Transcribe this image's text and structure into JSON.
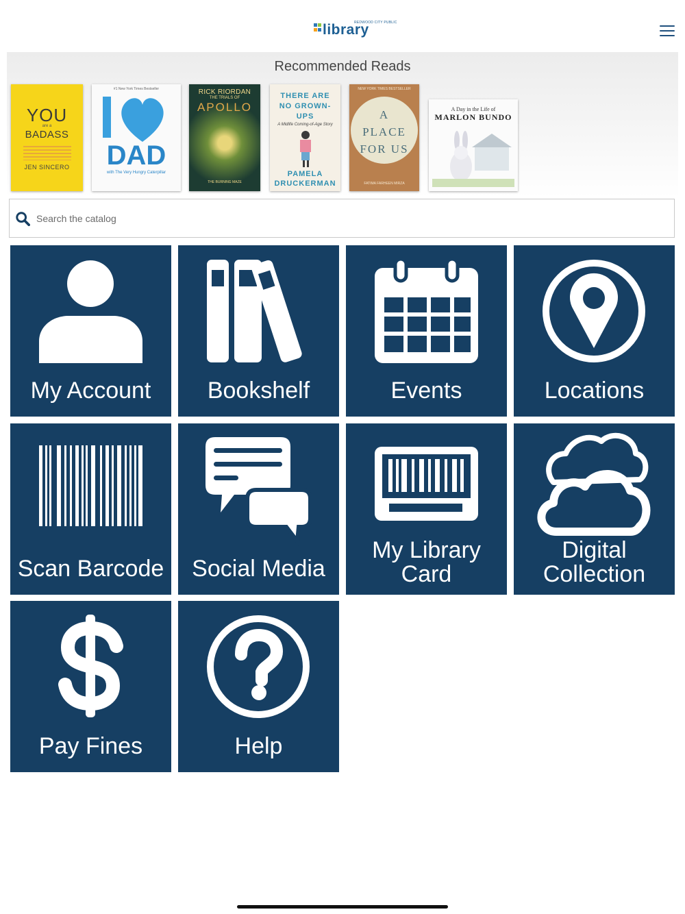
{
  "header": {
    "logo_small": "REDWOOD CITY PUBLIC",
    "logo_word": "library",
    "logo_mark_colors": [
      "#2e79b7",
      "#8cc63f",
      "#f7a21b",
      "#2e79b7"
    ],
    "menu_icon": "hamburger-menu-icon"
  },
  "recommended": {
    "title": "Recommended Reads",
    "books": [
      {
        "title_top": "YOU",
        "title_mid": "are a",
        "title_main": "BADASS",
        "author": "JEN SINCERO",
        "bg": "#f6d51a"
      },
      {
        "title_top": "#1 New York Times Bestseller",
        "title_main": "DAD",
        "subtitle": "with The Very Hungry Caterpillar",
        "bg": "#fafafa"
      },
      {
        "author": "RICK RIORDAN",
        "title_top": "THE TRIALS OF",
        "title_main": "APOLLO",
        "subtitle": "THE BURNING MAZE",
        "bg": "#1d3c32"
      },
      {
        "title_main": "THERE ARE NO GROWN-UPS",
        "subtitle": "A Midlife Coming-of-Age Story",
        "author": "PAMELA DRUCKERMAN",
        "bg": "#f5f0e6"
      },
      {
        "title_top": "NEW YORK TIMES BESTSELLER",
        "title_main": "A PLACE FOR US",
        "author": "FATIMA FARHEEN MIRZA",
        "bg": "#b9804e"
      },
      {
        "title_top": "A Day in the Life of",
        "title_main": "MARLON BUNDO",
        "bg": "#fbfbfb"
      }
    ]
  },
  "search": {
    "placeholder": "Search the catalog",
    "icon": "search-icon"
  },
  "tiles": [
    {
      "label": "My Account",
      "icon": "person-icon"
    },
    {
      "label": "Bookshelf",
      "icon": "bookshelf-icon"
    },
    {
      "label": "Events",
      "icon": "calendar-icon"
    },
    {
      "label": "Locations",
      "icon": "map-pin-icon"
    },
    {
      "label": "Scan Barcode",
      "icon": "barcode-icon"
    },
    {
      "label": "Social Media",
      "icon": "chat-bubbles-icon"
    },
    {
      "label_line1": "My Library",
      "label_line2": "Card",
      "icon": "library-card-icon"
    },
    {
      "label_line1": "Digital",
      "label_line2": "Collection",
      "icon": "cloud-icon"
    },
    {
      "label": "Pay Fines",
      "icon": "dollar-icon"
    },
    {
      "label": "Help",
      "icon": "help-icon"
    }
  ],
  "colors": {
    "tile": "#163f63",
    "brand": "#1d5f93"
  }
}
